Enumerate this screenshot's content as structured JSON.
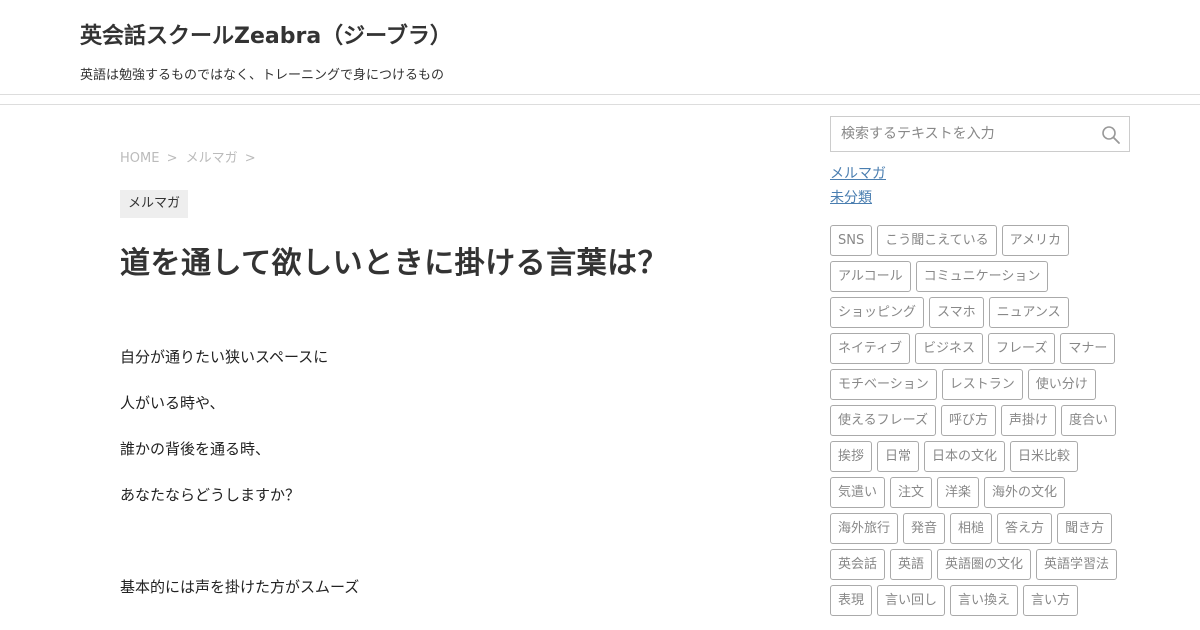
{
  "site": {
    "title": "英会話スクールZeabra（ジーブラ）",
    "description": "英語は勉強するものではなく、トレーニングで身につけるもの"
  },
  "breadcrumb": {
    "home": "HOME",
    "category": "メルマガ",
    "separator": ">"
  },
  "post": {
    "category": "メルマガ",
    "title": "道を通して欲しいときに掛ける言葉は？",
    "paragraphs": [
      "自分が通りたい狭いスペースに",
      "人がいる時や、",
      "誰かの背後を通る時、",
      "あなたならどうしますか？",
      "",
      "基本的には声を掛けた方がスムーズ"
    ]
  },
  "sidebar": {
    "search": {
      "placeholder": "検索するテキストを入力",
      "value": "",
      "icon": "search-icon"
    },
    "categories": [
      "メルマガ",
      "未分類"
    ],
    "tag_rows": [
      [
        "SNS",
        "こう聞こえている",
        "アメリカ"
      ],
      [
        "アルコール",
        "コミュニケーション"
      ],
      [
        "ショッピング",
        "スマホ",
        "ニュアンス"
      ],
      [
        "ネイティブ",
        "ビジネス",
        "フレーズ",
        "マナー"
      ],
      [
        "モチベーション",
        "レストラン",
        "使い分け"
      ],
      [
        "使えるフレーズ",
        "呼び方",
        "声掛け",
        "度合い"
      ],
      [
        "挨拶",
        "日常",
        "日本の文化",
        "日米比較"
      ],
      [
        "気遣い",
        "注文",
        "洋楽",
        "海外の文化"
      ],
      [
        "海外旅行",
        "発音",
        "相槌",
        "答え方",
        "聞き方"
      ],
      [
        "英会話",
        "英語",
        "英語圏の文化",
        "英語学習法"
      ],
      [
        "表現",
        "言い回し",
        "言い換え",
        "言い方"
      ]
    ]
  },
  "colors": {
    "link": "#4a7eb0",
    "tag_border": "#aaaaaa",
    "tag_text": "#888888",
    "category_bg": "#eeeeee"
  }
}
